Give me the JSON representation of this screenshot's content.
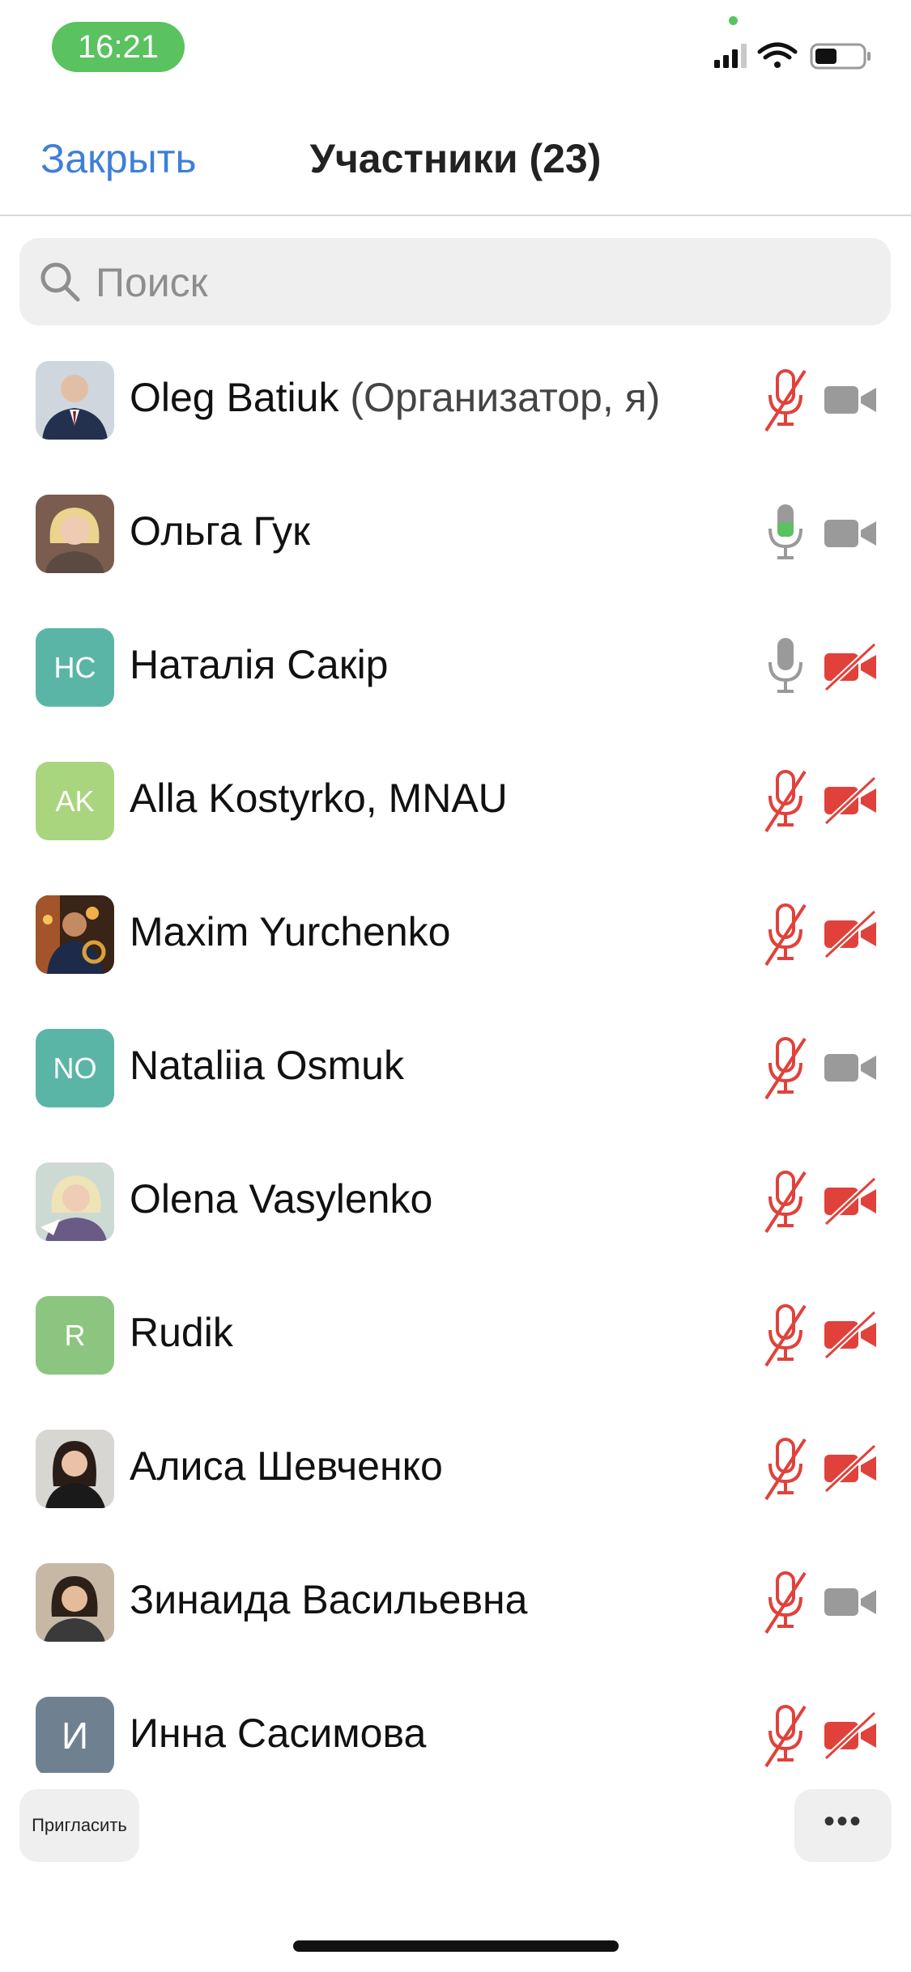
{
  "status_bar": {
    "time": "16:21",
    "icons": [
      "cellular-signal-icon",
      "wifi-icon",
      "battery-icon"
    ]
  },
  "header": {
    "close_label": "Закрыть",
    "title": "Участники (23)"
  },
  "search": {
    "placeholder": "Поиск",
    "value": ""
  },
  "colors": {
    "accent": "#3f7fd6",
    "muted_red": "#e0423b",
    "active_green": "#5ac25f",
    "icon_gray": "#9a9a9a"
  },
  "participants": [
    {
      "name": "Oleg Batiuk",
      "role": "(Организатор, я)",
      "avatar_type": "photo",
      "mic": "muted",
      "video": "on"
    },
    {
      "name": "Ольга Гук",
      "avatar_type": "photo",
      "mic": "speaking",
      "video": "on"
    },
    {
      "name": "Наталія Сакір",
      "avatar_initials": "НС",
      "avatar_color": "#5bb5a7",
      "mic": "on",
      "video": "off"
    },
    {
      "name": "Alla Kostyrko, MNAU",
      "avatar_initials": "AK",
      "avatar_color": "#a9d57f",
      "mic": "muted",
      "video": "off"
    },
    {
      "name": "Maxim Yurchenko",
      "avatar_type": "photo",
      "mic": "muted",
      "video": "off"
    },
    {
      "name": "Nataliia Osmuk",
      "avatar_initials": "NO",
      "avatar_color": "#5bb5a7",
      "mic": "muted",
      "video": "on"
    },
    {
      "name": "Olena Vasylenko",
      "avatar_type": "photo",
      "mic": "muted",
      "video": "off"
    },
    {
      "name": "Rudik",
      "avatar_initials": "R",
      "avatar_color": "#8cc57f",
      "mic": "muted",
      "video": "off"
    },
    {
      "name": "Алиса Шевченко",
      "avatar_type": "photo",
      "mic": "muted",
      "video": "off"
    },
    {
      "name": "Зинаида Васильевна",
      "avatar_type": "photo",
      "mic": "muted",
      "video": "on"
    },
    {
      "name": "Инна Сасимова",
      "avatar_initials": "И",
      "avatar_color": "#6f8190",
      "mic": "muted",
      "video": "off"
    }
  ],
  "footer": {
    "invite_label": "Пригласить",
    "more_label": "•••"
  }
}
